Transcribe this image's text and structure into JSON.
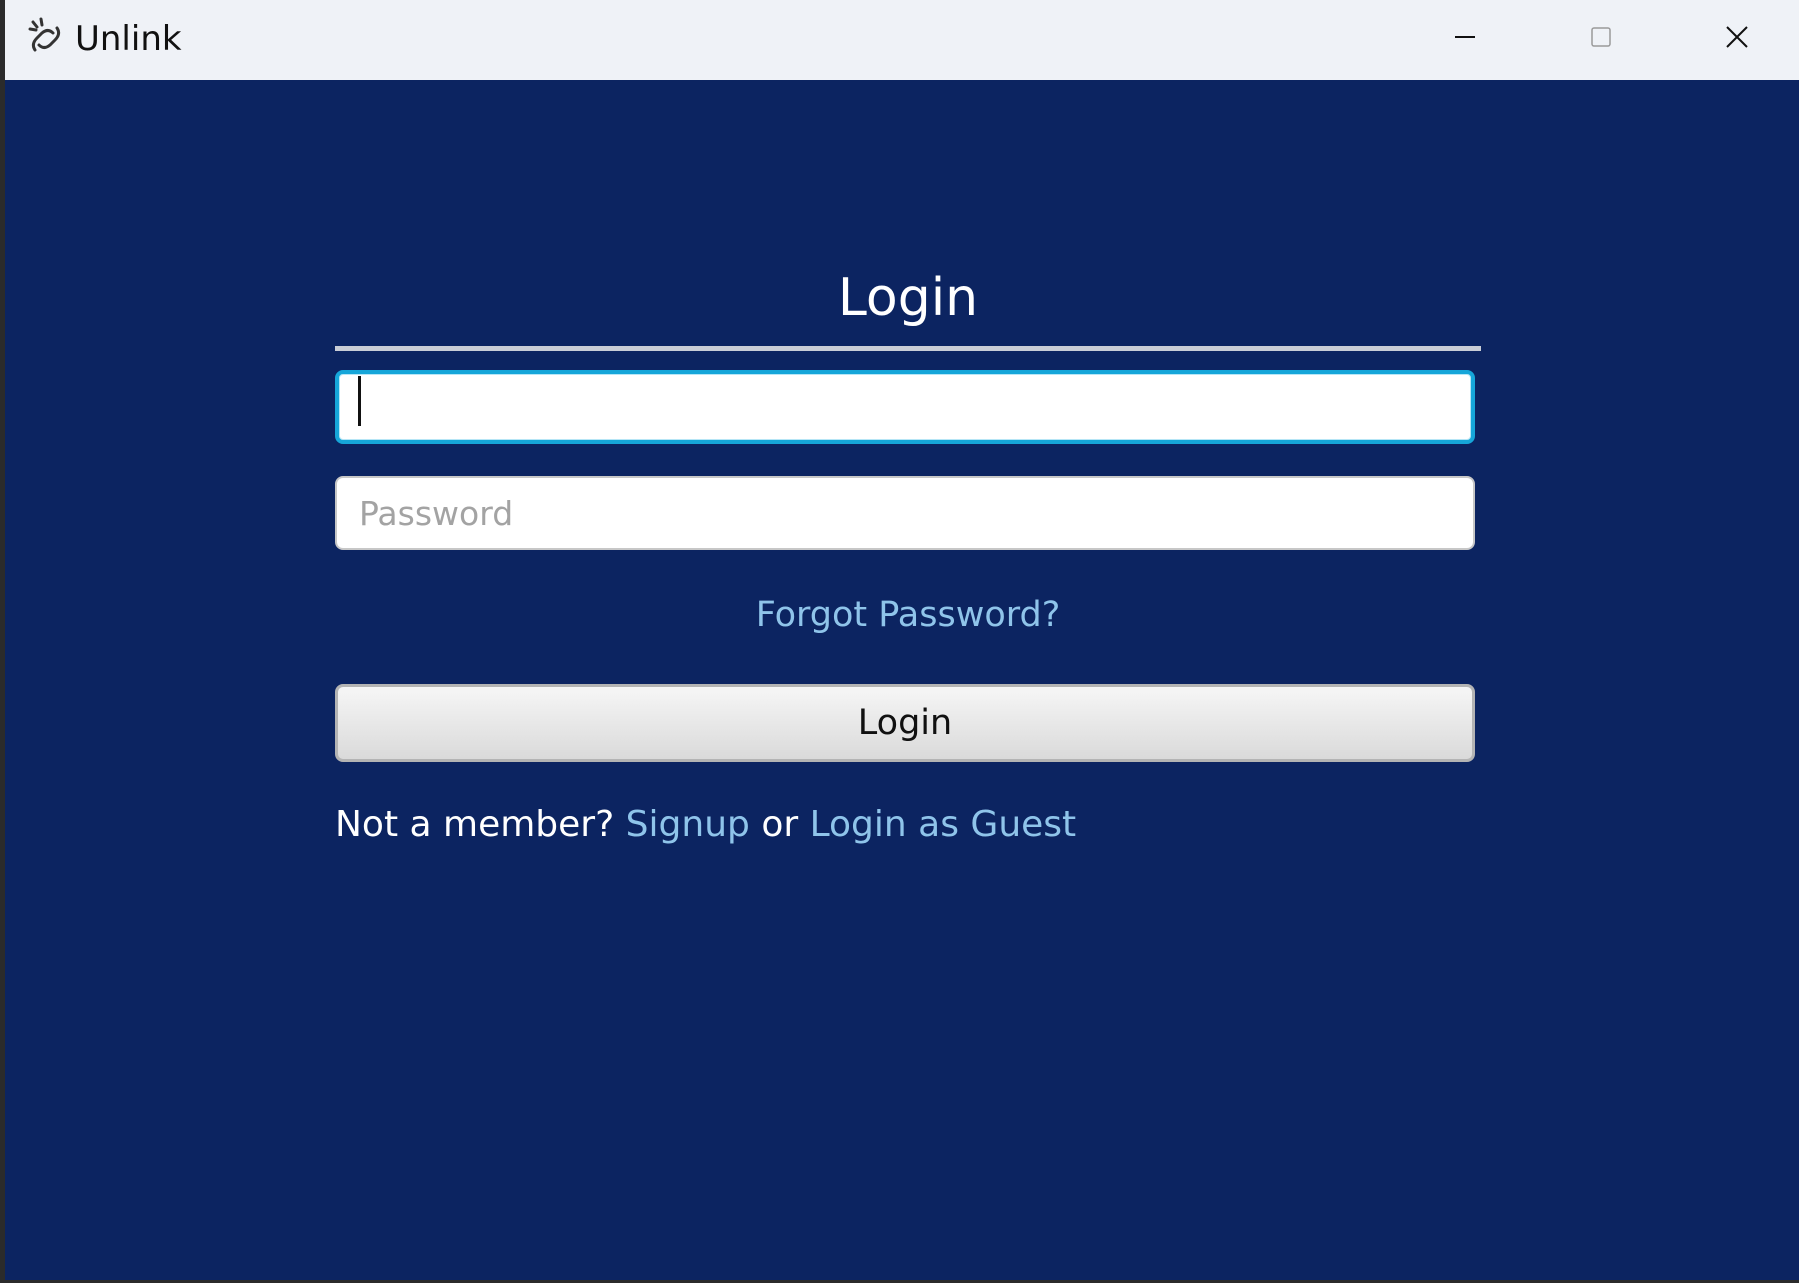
{
  "window": {
    "title": "Unlink",
    "background_color": "#0c2461",
    "titlebar_color": "#eff2f7",
    "controls": {
      "minimize_icon": "minimize-icon",
      "maximize_icon": "maximize-icon",
      "close_icon": "close-icon"
    }
  },
  "login": {
    "heading": "Login",
    "username": {
      "value": "",
      "placeholder": "",
      "focused": true
    },
    "password": {
      "value": "",
      "placeholder": "Password"
    },
    "forgot_password": "Forgot Password?",
    "login_button": "Login",
    "footer": {
      "prompt": "Not a member?",
      "signup_link": "Signup",
      "or": "or",
      "guest_link": "Login as Guest"
    },
    "link_color": "#8fc4ea",
    "focus_color": "#16a6d9"
  }
}
